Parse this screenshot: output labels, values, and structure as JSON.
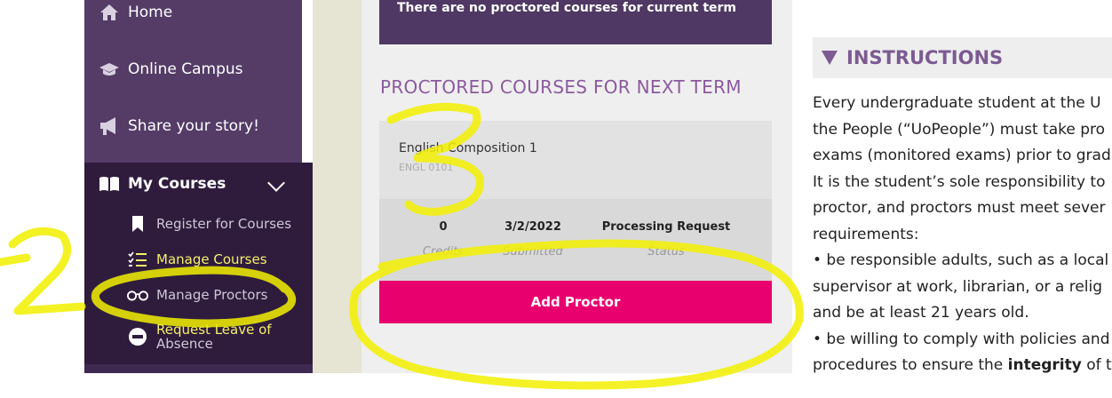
{
  "sidebar": {
    "items": [
      {
        "label": "Home",
        "icon": "home-icon"
      },
      {
        "label": "Online Campus",
        "icon": "graduation-cap-icon"
      },
      {
        "label": "Share your story!",
        "icon": "megaphone-icon"
      }
    ],
    "my_courses": {
      "label": "My Courses",
      "icon": "book-icon",
      "subitems": [
        {
          "label": "Register for Courses",
          "icon": "bookmark-icon"
        },
        {
          "label": "Manage Courses",
          "icon": "list-icon"
        },
        {
          "label": "Manage Proctors",
          "icon": "glasses-icon"
        },
        {
          "label_line1": "Request Leave of",
          "label_line2": "Absence",
          "icon": "minus-circle-icon"
        }
      ]
    }
  },
  "main": {
    "banner": "There are no proctored courses for current term",
    "section_title": "PROCTORED COURSES FOR NEXT TERM",
    "course": {
      "name": "English Composition 1",
      "code": "ENGL 0101",
      "credits_value": "0",
      "credits_label": "Credits",
      "submitted_value": "3/2/2022",
      "submitted_label": "Submitted",
      "status_value": "Processing Request",
      "status_label": "Status"
    },
    "add_proctor": "Add Proctor"
  },
  "instructions": {
    "title": "INSTRUCTIONS",
    "lines": [
      "Every undergraduate student at the U",
      "the People (“UoPeople”) must take pro",
      "exams (monitored exams) prior to grad",
      "It is the student’s sole responsibility to",
      "proctor, and proctors must meet sever",
      "requirements:",
      "• be responsible adults, such as a local",
      "supervisor at work, librarian, or a relig",
      "and be at least 21 years old.",
      "• be willing to comply with policies and",
      "procedures to ensure the "
    ],
    "bold_word": "integrity",
    "tail": " of t"
  },
  "annotations": {
    "label_left": "2",
    "label_center": "3",
    "color": "#f2f000"
  },
  "colors": {
    "sidebar": "#543c67",
    "sidebar_dark": "#2f1c3d",
    "accent_pink": "#e9006f",
    "accent_purple": "#8b5a9e",
    "active_yellow": "#f4ef6b"
  }
}
